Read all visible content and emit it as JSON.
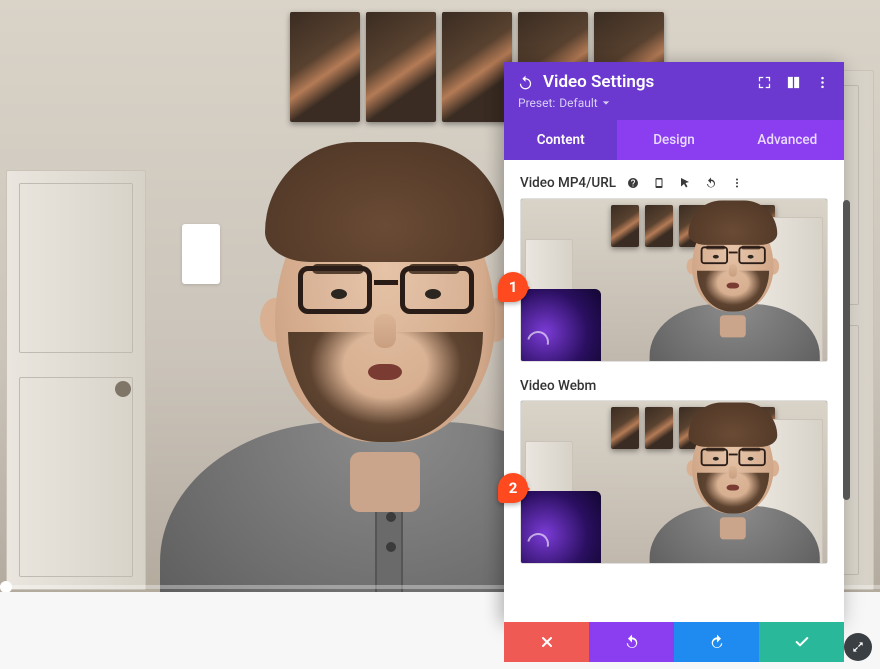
{
  "panel": {
    "title": "Video Settings",
    "preset_label": "Preset:",
    "preset_value": "Default",
    "tabs": {
      "content": "Content",
      "design": "Design",
      "advanced": "Advanced"
    },
    "active_tab": "content",
    "fields": {
      "mp4_label": "Video MP4/URL",
      "webm_label": "Video Webm"
    }
  },
  "annotations": {
    "marker1": "1",
    "marker2": "2"
  },
  "colors": {
    "purple_dark": "#6b39cf",
    "purple_light": "#8a3ef0",
    "red": "#f05a54",
    "blue": "#1f8bf1",
    "green": "#29b99a",
    "annotation": "#ff4a1f"
  }
}
